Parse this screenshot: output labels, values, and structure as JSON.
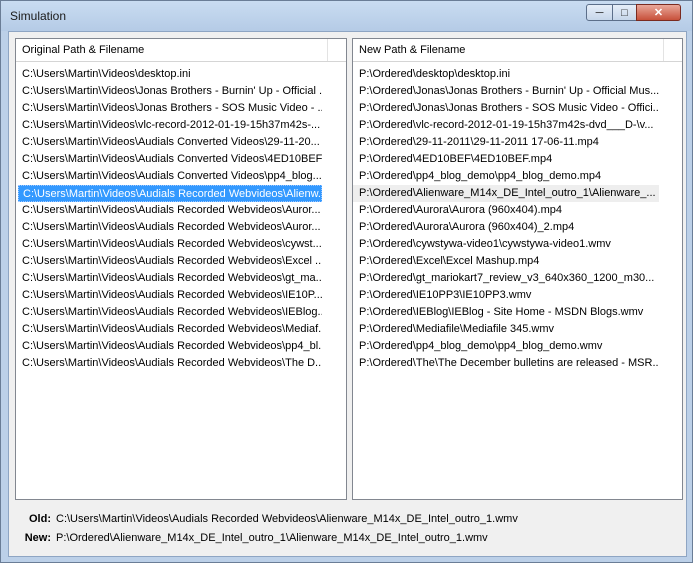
{
  "window": {
    "title": "Simulation"
  },
  "controls": {
    "minimize": "─",
    "maximize": "□",
    "close": "✕"
  },
  "left": {
    "header": "Original Path & Filename",
    "rows": [
      "C:\\Users\\Martin\\Videos\\desktop.ini",
      "C:\\Users\\Martin\\Videos\\Jonas Brothers - Burnin' Up - Official ...",
      "C:\\Users\\Martin\\Videos\\Jonas Brothers - SOS Music Video - ...",
      "C:\\Users\\Martin\\Videos\\vlc-record-2012-01-19-15h37m42s-...",
      "C:\\Users\\Martin\\Videos\\Audials Converted Videos\\29-11-20...",
      "C:\\Users\\Martin\\Videos\\Audials Converted Videos\\4ED10BEF...",
      "C:\\Users\\Martin\\Videos\\Audials Converted Videos\\pp4_blog...",
      "C:\\Users\\Martin\\Videos\\Audials Recorded Webvideos\\Alienw...",
      "C:\\Users\\Martin\\Videos\\Audials Recorded Webvideos\\Auror...",
      "C:\\Users\\Martin\\Videos\\Audials Recorded Webvideos\\Auror...",
      "C:\\Users\\Martin\\Videos\\Audials Recorded Webvideos\\cywst...",
      "C:\\Users\\Martin\\Videos\\Audials Recorded Webvideos\\Excel ...",
      "C:\\Users\\Martin\\Videos\\Audials Recorded Webvideos\\gt_ma...",
      "C:\\Users\\Martin\\Videos\\Audials Recorded Webvideos\\IE10P...",
      "C:\\Users\\Martin\\Videos\\Audials Recorded Webvideos\\IEBlog...",
      "C:\\Users\\Martin\\Videos\\Audials Recorded Webvideos\\Mediaf...",
      "C:\\Users\\Martin\\Videos\\Audials Recorded Webvideos\\pp4_bl...",
      "C:\\Users\\Martin\\Videos\\Audials Recorded Webvideos\\The D..."
    ]
  },
  "right": {
    "header": "New Path & Filename",
    "rows": [
      "P:\\Ordered\\desktop\\desktop.ini",
      "P:\\Ordered\\Jonas\\Jonas Brothers - Burnin' Up - Official Mus...",
      "P:\\Ordered\\Jonas\\Jonas Brothers - SOS Music Video - Offici...",
      "P:\\Ordered\\vlc-record-2012-01-19-15h37m42s-dvd___D-\\v...",
      "P:\\Ordered\\29-11-2011\\29-11-2011 17-06-11.mp4",
      "P:\\Ordered\\4ED10BEF\\4ED10BEF.mp4",
      "P:\\Ordered\\pp4_blog_demo\\pp4_blog_demo.mp4",
      "P:\\Ordered\\Alienware_M14x_DE_Intel_outro_1\\Alienware_...",
      "P:\\Ordered\\Aurora\\Aurora (960x404).mp4",
      "P:\\Ordered\\Aurora\\Aurora (960x404)_2.mp4",
      "P:\\Ordered\\cywstywa-video1\\cywstywa-video1.wmv",
      "P:\\Ordered\\Excel\\Excel Mashup.mp4",
      "P:\\Ordered\\gt_mariokart7_review_v3_640x360_1200_m30...",
      "P:\\Ordered\\IE10PP3\\IE10PP3.wmv",
      "P:\\Ordered\\IEBlog\\IEBlog - Site Home - MSDN Blogs.wmv",
      "P:\\Ordered\\Mediafile\\Mediafile 345.wmv",
      "P:\\Ordered\\pp4_blog_demo\\pp4_blog_demo.wmv",
      "P:\\Ordered\\The\\The December bulletins are released - MSR..."
    ]
  },
  "selected_index": 7,
  "footer": {
    "old_label": "Old:",
    "old_value": "C:\\Users\\Martin\\Videos\\Audials Recorded Webvideos\\Alienware_M14x_DE_Intel_outro_1.wmv",
    "new_label": "New:",
    "new_value": "P:\\Ordered\\Alienware_M14x_DE_Intel_outro_1\\Alienware_M14x_DE_Intel_outro_1.wmv"
  }
}
